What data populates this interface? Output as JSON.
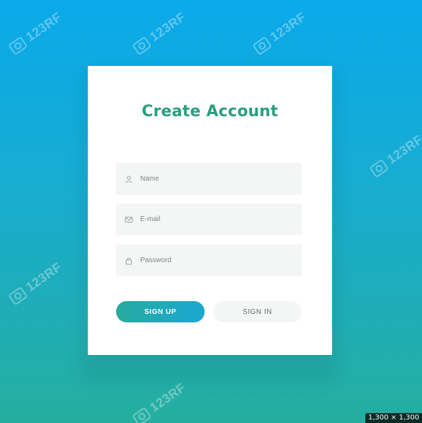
{
  "watermarks": {
    "text": "123RF"
  },
  "card": {
    "title": "Create Account",
    "fields": [
      {
        "icon": "user-icon",
        "placeholder": "Name"
      },
      {
        "icon": "mail-icon",
        "placeholder": "E-mail"
      },
      {
        "icon": "lock-icon",
        "placeholder": "Password"
      }
    ],
    "buttons": {
      "signup_label": "SIGN UP",
      "signin_label": "SIGN IN"
    }
  },
  "corner_badge": {
    "text": "1,300 × 1,300"
  },
  "colors": {
    "background_top": "#0aa9ea",
    "background_bottom": "#25ae9f",
    "title": "#2a9f7f",
    "button_primary_start": "#27aa9e",
    "button_primary_end": "#1aa8d3",
    "field_bg": "#f4f6f6"
  }
}
